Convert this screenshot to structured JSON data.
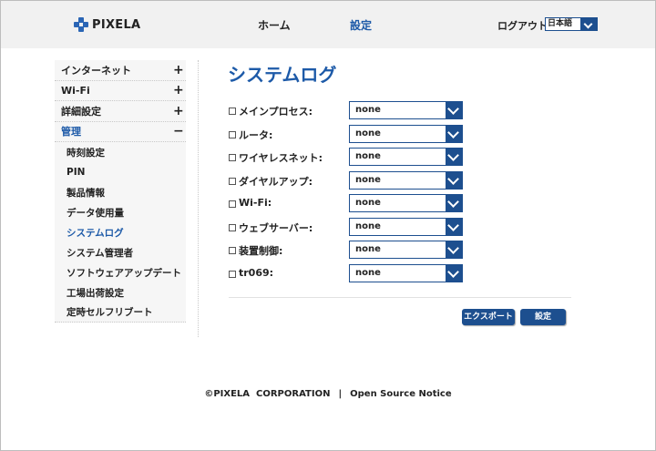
{
  "header": {
    "logo_text": "PIXELA",
    "nav": {
      "home": "ホーム",
      "settings": "設定"
    },
    "logout": "ログアウト",
    "language": "日本語"
  },
  "sidebar": {
    "items": [
      {
        "label": "インターネット",
        "sign": "+"
      },
      {
        "label": "Wi-Fi",
        "sign": "+"
      },
      {
        "label": "詳細設定",
        "sign": "+"
      },
      {
        "label": "管理",
        "sign": "−"
      }
    ],
    "sub_items": [
      "時刻設定",
      "PIN",
      "製品情報",
      "データ使用量",
      "システムログ",
      "システム管理者",
      "ソフトウェアアップデート",
      "工場出荷設定",
      "定時セルフリブート"
    ]
  },
  "main": {
    "title": "システムログ",
    "rows": [
      {
        "label": "メインプロセス:",
        "value": "none"
      },
      {
        "label": "ルータ:",
        "value": "none"
      },
      {
        "label": "ワイヤレスネット:",
        "value": "none"
      },
      {
        "label": "ダイヤルアップ:",
        "value": "none"
      },
      {
        "label": "Wi-Fi:",
        "value": "none"
      },
      {
        "label": "ウェブサーバー:",
        "value": "none"
      },
      {
        "label": "装置制御:",
        "value": "none"
      },
      {
        "label": "tr069:",
        "value": "none"
      }
    ],
    "export_button": "エクスポート",
    "apply_button": "設定"
  },
  "footer": {
    "copyright": "©PIXELA  CORPORATION",
    "separator": "|",
    "notice": "Open Source Notice"
  },
  "colors": {
    "accent": "#1d5aa8",
    "control": "#1d4f8f"
  }
}
